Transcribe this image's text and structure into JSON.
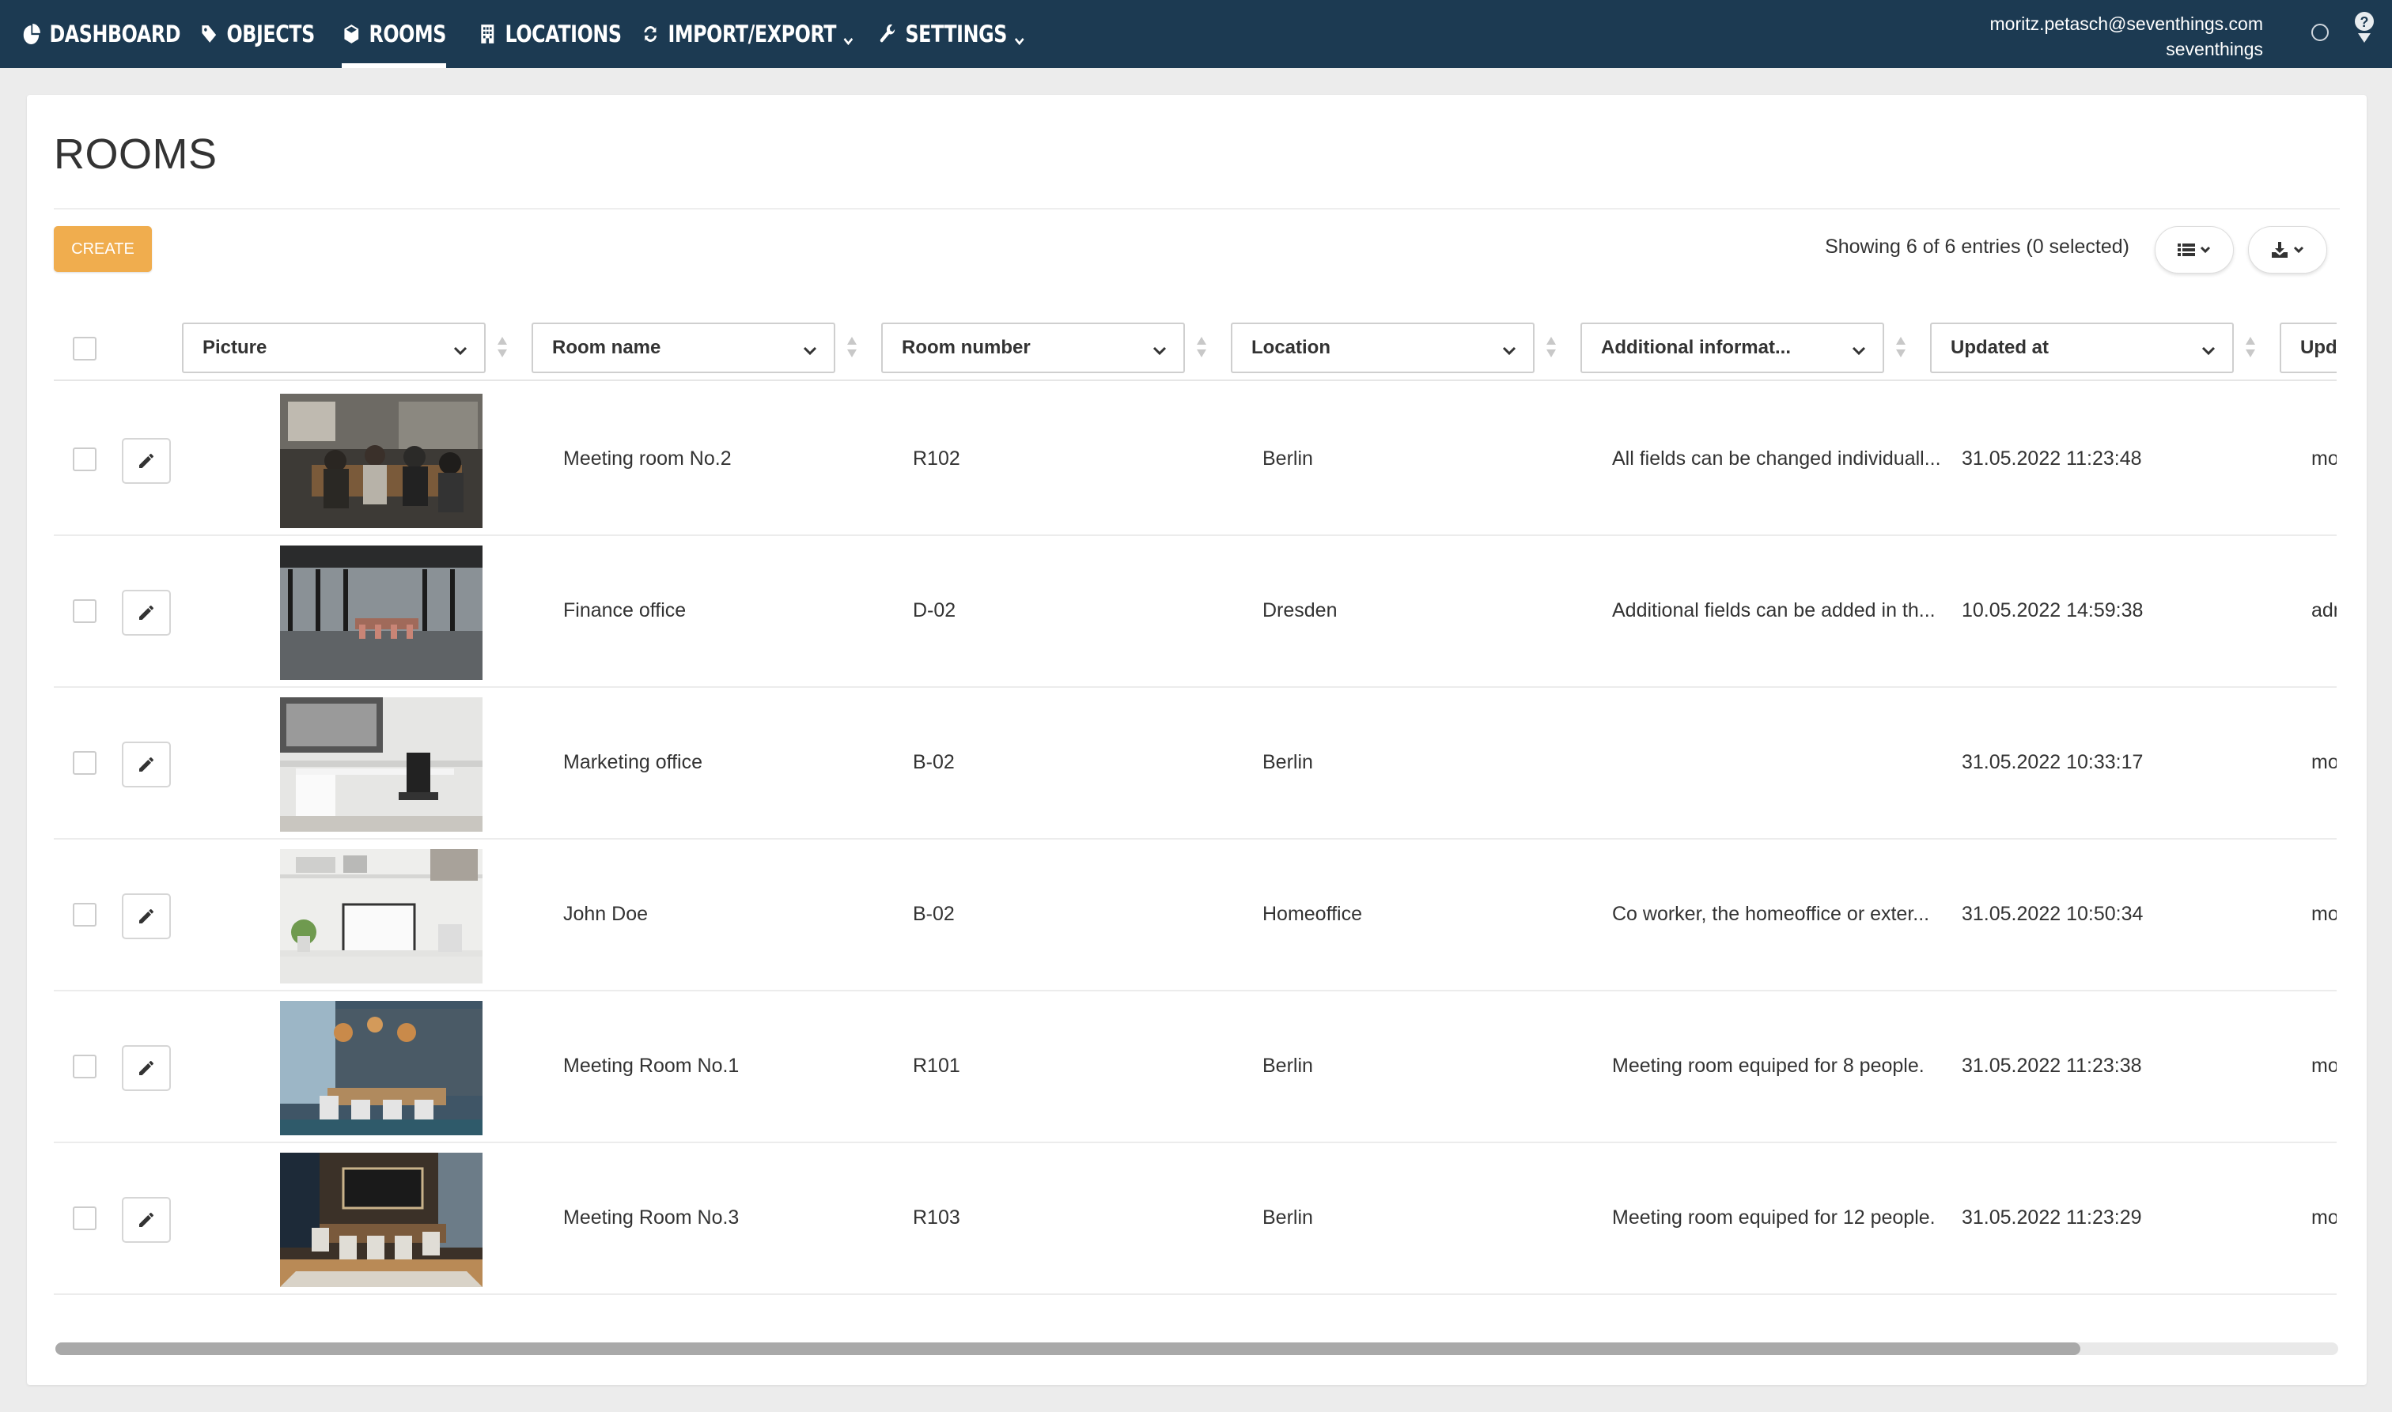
{
  "nav": {
    "items": [
      {
        "label": "DASHBOARD",
        "icon": "pie-chart-icon",
        "active": false
      },
      {
        "label": "OBJECTS",
        "icon": "tag-icon",
        "active": false
      },
      {
        "label": "ROOMS",
        "icon": "cube-icon",
        "active": true
      },
      {
        "label": "LOCATIONS",
        "icon": "building-icon",
        "active": false
      },
      {
        "label": "IMPORT/EXPORT",
        "icon": "refresh-icon",
        "active": false,
        "dropdown": true
      },
      {
        "label": "SETTINGS",
        "icon": "wrench-icon",
        "active": false,
        "dropdown": true
      }
    ],
    "user_email": "moritz.petasch@seventhings.com",
    "user_org": "seventhings"
  },
  "page": {
    "title": "ROOMS",
    "create_label": "CREATE",
    "showing": "Showing 6 of 6 entries (0 selected)"
  },
  "table": {
    "columns": [
      "Picture",
      "Room name",
      "Room number",
      "Location",
      "Additional informat...",
      "Updated at",
      "Upd"
    ],
    "rows": [
      {
        "name": "Meeting room No.2",
        "number": "R102",
        "location": "Berlin",
        "info": "All fields can be changed individuall...",
        "updated_at": "31.05.2022 11:23:48",
        "updated_by": "moritz",
        "picture": "team-meeting-photo"
      },
      {
        "name": "Finance office",
        "number": "D-02",
        "location": "Dresden",
        "info": "Additional fields can be added in th...",
        "updated_at": "10.05.2022 14:59:38",
        "updated_by": "admin",
        "picture": "open-office-photo"
      },
      {
        "name": "Marketing office",
        "number": "B-02",
        "location": "Berlin",
        "info": "",
        "updated_at": "31.05.2022 10:33:17",
        "updated_by": "moritz",
        "picture": "white-desk-photo"
      },
      {
        "name": "John Doe",
        "number": "B-02",
        "location": "Homeoffice",
        "info": "Co worker, the homeoffice or exter...",
        "updated_at": "31.05.2022 10:50:34",
        "updated_by": "moritz",
        "picture": "home-desk-photo"
      },
      {
        "name": "Meeting Room No.1",
        "number": "R101",
        "location": "Berlin",
        "info": "Meeting room equiped for 8 people.",
        "updated_at": "31.05.2022 11:23:38",
        "updated_by": "moritz",
        "picture": "conference-room-photo"
      },
      {
        "name": "Meeting Room No.3",
        "number": "R103",
        "location": "Berlin",
        "info": "Meeting room equiped for 12 people.",
        "updated_at": "31.05.2022 11:23:29",
        "updated_by": "moritz",
        "picture": "boardroom-photo"
      }
    ]
  },
  "colors": {
    "nav_bg": "#1c3a52",
    "create_btn": "#f0ad4e",
    "page_bg": "#ececec"
  }
}
